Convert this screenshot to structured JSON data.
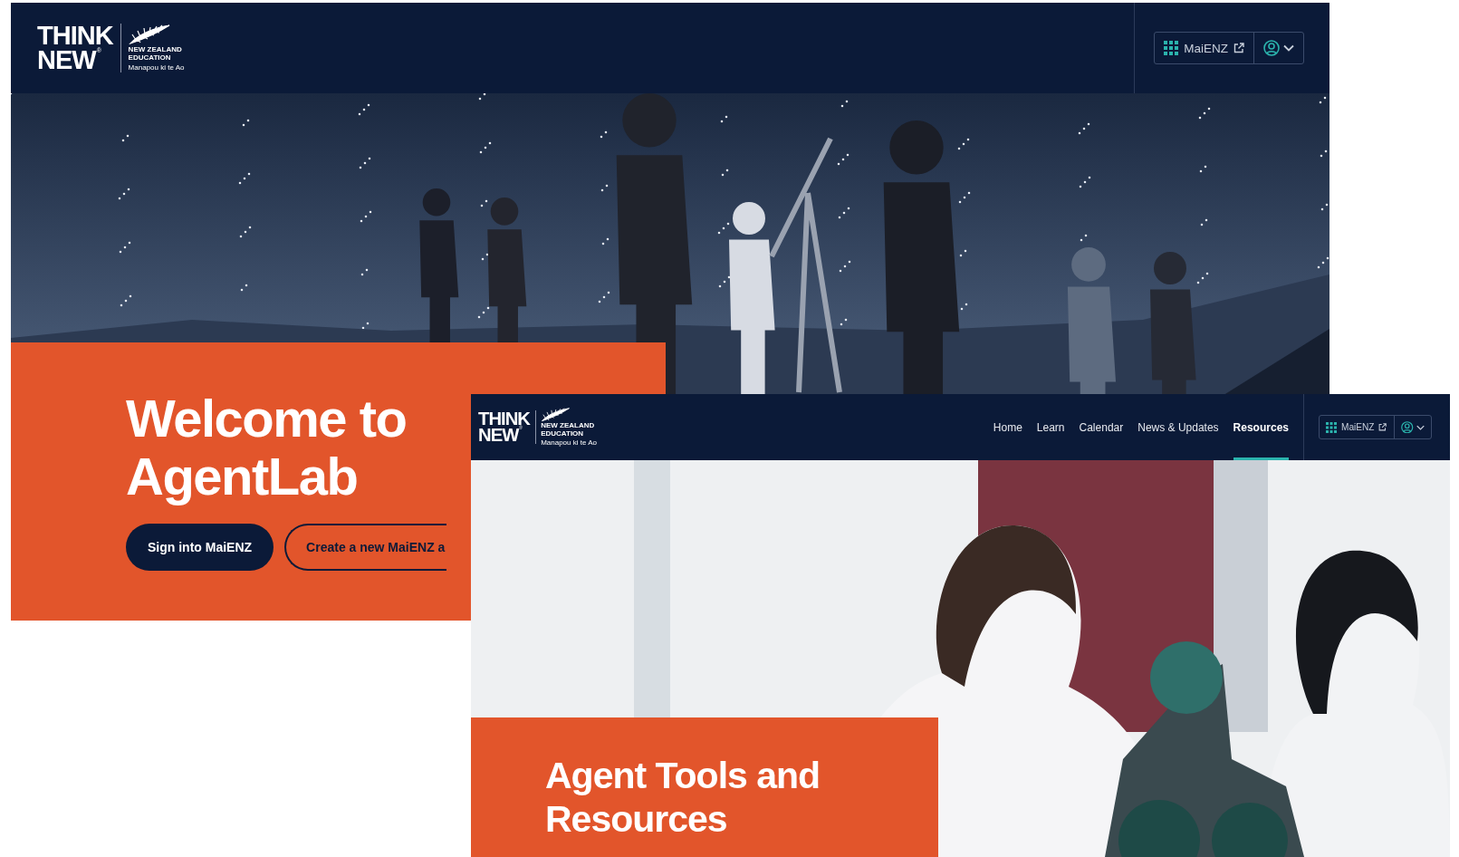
{
  "welcome_page": {
    "logo": {
      "wordmark_top": "THINK",
      "wordmark_bottom": "NEW",
      "mark": "®",
      "org": "NEW ZEALAND EDUCATION",
      "tagline": "Manapou ki te Ao"
    },
    "account": {
      "label": "MaiENZ"
    },
    "heading": "Welcome to AgentLab",
    "buttons": [
      {
        "label": "Sign into MaiENZ",
        "kind": "primary"
      },
      {
        "label": "Create a new MaiENZ a",
        "kind": "outline"
      }
    ]
  },
  "resources_page": {
    "logo": {
      "wordmark_top": "THINK",
      "wordmark_bottom": "NEW",
      "mark": "®",
      "org": "NEW ZEALAND EDUCATION",
      "tagline": "Manapou ki te Ao"
    },
    "nav": [
      {
        "label": "Home",
        "selected": false
      },
      {
        "label": "Learn",
        "selected": false
      },
      {
        "label": "Calendar",
        "selected": false
      },
      {
        "label": "News & Updates",
        "selected": false
      },
      {
        "label": "Resources",
        "selected": true
      }
    ],
    "account": {
      "label": "MaiENZ"
    },
    "heading": "Agent Tools and Resources"
  }
}
